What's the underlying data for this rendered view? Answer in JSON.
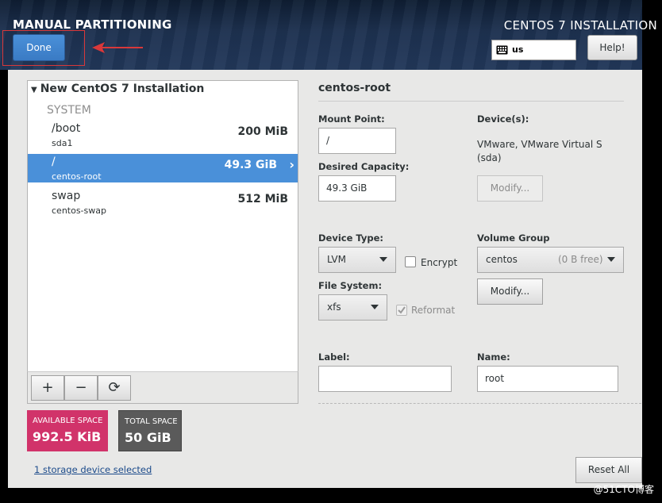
{
  "header": {
    "title": "MANUAL PARTITIONING",
    "install_title": "CENTOS 7 INSTALLATION",
    "done_label": "Done",
    "keyboard_layout": "us",
    "help_label": "Help!"
  },
  "mount_list": {
    "installation_name": "New CentOS 7 Installation",
    "group_label": "SYSTEM",
    "items": [
      {
        "mount": "/boot",
        "device": "sda1",
        "size": "200 MiB"
      },
      {
        "mount": "/",
        "device": "centos-root",
        "size": "49.3 GiB"
      },
      {
        "mount": "swap",
        "device": "centos-swap",
        "size": "512 MiB"
      }
    ]
  },
  "toolbar": {
    "add": "+",
    "remove": "−",
    "refresh": "⟳"
  },
  "space": {
    "available_label": "AVAILABLE SPACE",
    "available_value": "992.5 KiB",
    "total_label": "TOTAL SPACE",
    "total_value": "50 GiB"
  },
  "storage_link": "1 storage device selected",
  "reset_label": "Reset All",
  "detail": {
    "title": "centos-root",
    "mount_point_label": "Mount Point:",
    "mount_point_value": "/",
    "desired_capacity_label": "Desired Capacity:",
    "desired_capacity_value": "49.3 GiB",
    "devices_label": "Device(s):",
    "devices_value_line1": "VMware, VMware Virtual S",
    "devices_value_line2": "(sda)",
    "devices_modify_label": "Modify...",
    "device_type_label": "Device Type:",
    "device_type_value": "LVM",
    "encrypt_label": "Encrypt",
    "volume_group_label": "Volume Group",
    "volume_group_value": "centos",
    "volume_group_free": "(0 B free)",
    "volume_group_modify_label": "Modify...",
    "file_system_label": "File System:",
    "file_system_value": "xfs",
    "reformat_label": "Reformat",
    "label_label": "Label:",
    "label_value": "",
    "name_label": "Name:",
    "name_value": "root"
  },
  "watermark": "@51CTO博客",
  "colors": {
    "accent": "#4a90d9",
    "available": "#d1336a",
    "total": "#5a5a5a",
    "highlight": "#d9383a"
  }
}
